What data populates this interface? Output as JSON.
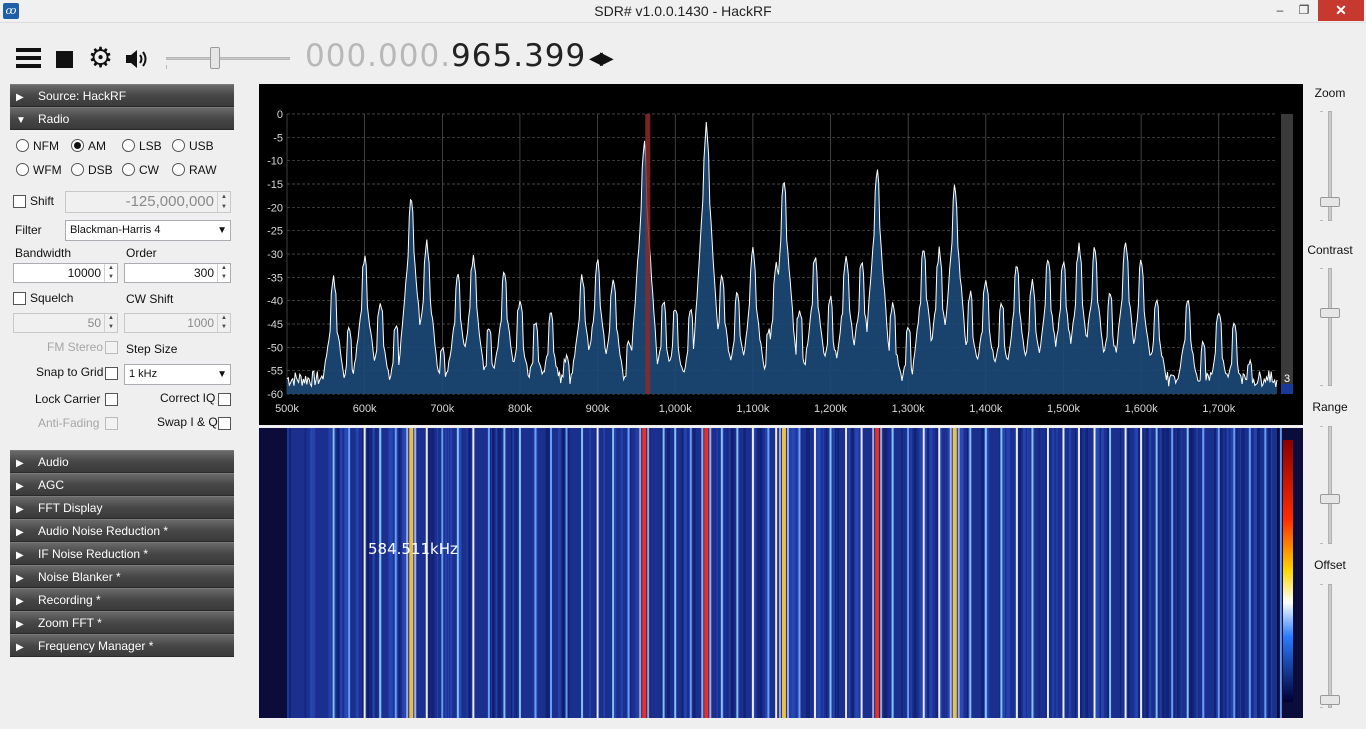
{
  "window": {
    "title": "SDR# v1.0.0.1430 - HackRF",
    "minimize": "–",
    "maximize": "❐",
    "close": "✕"
  },
  "toolbar": {
    "menu_icon": "hamburger-menu-icon",
    "stop_icon": "stop-icon",
    "settings_icon": "gear-icon",
    "audio_icon": "speaker-icon",
    "frequency_dim": "000.000.",
    "frequency_lit": "965.399",
    "tuning_arrows": "◀▶"
  },
  "left_panel": {
    "source_header": "Source: HackRF",
    "radio_header": "Radio",
    "modes": [
      "NFM",
      "AM",
      "LSB",
      "USB",
      "WFM",
      "DSB",
      "CW",
      "RAW"
    ],
    "selected_mode": "AM",
    "shift_label": "Shift",
    "shift_value": "-125,000,000",
    "filter_label": "Filter",
    "filter_value": "Blackman-Harris 4",
    "bandwidth_label": "Bandwidth",
    "bandwidth_value": "10000",
    "order_label": "Order",
    "order_value": "300",
    "squelch_label": "Squelch",
    "squelch_value": "50",
    "cw_shift_label": "CW Shift",
    "cw_shift_value": "1000",
    "fm_stereo_label": "FM Stereo",
    "step_size_label": "Step Size",
    "snap_to_grid_label": "Snap to Grid",
    "step_size_value": "1 kHz",
    "lock_carrier_label": "Lock Carrier",
    "correct_iq_label": "Correct IQ",
    "anti_fading_label": "Anti-Fading",
    "swap_iq_label": "Swap I & Q",
    "sections": [
      "Audio",
      "AGC",
      "FFT Display",
      "Audio Noise Reduction *",
      "IF Noise Reduction *",
      "Noise Blanker *",
      "Recording *",
      "Zoom FFT *",
      "Frequency Manager *"
    ]
  },
  "spectrum": {
    "y_ticks": [
      "0",
      "-5",
      "-10",
      "-15",
      "-20",
      "-25",
      "-30",
      "-35",
      "-40",
      "-45",
      "-50",
      "-55",
      "-60"
    ],
    "x_ticks": [
      "500k",
      "600k",
      "700k",
      "800k",
      "900k",
      "1,000k",
      "1,100k",
      "1,200k",
      "1,300k",
      "1,400k",
      "1,500k",
      "1,600k",
      "1,700k"
    ],
    "scale_indicator": "3",
    "colors": {
      "background": "#000000",
      "fill": "#1c4a78",
      "trace": "#ffffff",
      "grid": "#5a5a5a",
      "tuned_marker": "#8b2a2a"
    },
    "peaks_khz": [
      [
        560,
        -35
      ],
      [
        580,
        -46
      ],
      [
        600,
        -30
      ],
      [
        620,
        -40
      ],
      [
        640,
        -45
      ],
      [
        660,
        -17
      ],
      [
        680,
        -27
      ],
      [
        700,
        -50
      ],
      [
        720,
        -34
      ],
      [
        740,
        -30
      ],
      [
        760,
        -45
      ],
      [
        780,
        -33
      ],
      [
        800,
        -40
      ],
      [
        820,
        -44
      ],
      [
        840,
        -42
      ],
      [
        860,
        -52
      ],
      [
        880,
        -34
      ],
      [
        900,
        -31
      ],
      [
        920,
        -35
      ],
      [
        940,
        -49
      ],
      [
        960,
        -5
      ],
      [
        985,
        -40
      ],
      [
        1000,
        -41
      ],
      [
        1020,
        -42
      ],
      [
        1040,
        -1
      ],
      [
        1060,
        -34
      ],
      [
        1080,
        -38
      ],
      [
        1100,
        -29
      ],
      [
        1120,
        -46
      ],
      [
        1130,
        -32
      ],
      [
        1140,
        -13
      ],
      [
        1160,
        -42
      ],
      [
        1180,
        -30
      ],
      [
        1200,
        -39
      ],
      [
        1220,
        -30
      ],
      [
        1240,
        -31
      ],
      [
        1260,
        -11
      ],
      [
        1280,
        -41
      ],
      [
        1300,
        -45
      ],
      [
        1320,
        -28
      ],
      [
        1340,
        -29
      ],
      [
        1360,
        -14
      ],
      [
        1380,
        -38
      ],
      [
        1400,
        -35
      ],
      [
        1420,
        -40
      ],
      [
        1440,
        -32
      ],
      [
        1460,
        -36
      ],
      [
        1480,
        -30
      ],
      [
        1500,
        -31
      ],
      [
        1520,
        -28
      ],
      [
        1540,
        -28
      ],
      [
        1560,
        -38
      ],
      [
        1580,
        -27
      ],
      [
        1600,
        -31
      ],
      [
        1620,
        -39
      ],
      [
        1640,
        -56
      ],
      [
        1660,
        -39
      ],
      [
        1680,
        -49
      ],
      [
        1700,
        -42
      ],
      [
        1720,
        -45
      ],
      [
        1740,
        -53
      ],
      [
        1760,
        -57
      ],
      [
        1780,
        -55
      ]
    ]
  },
  "waterfall": {
    "readout": "584.511kHz"
  },
  "right_panel": {
    "zoom_label": "Zoom",
    "contrast_label": "Contrast",
    "range_label": "Range",
    "offset_label": "Offset"
  }
}
